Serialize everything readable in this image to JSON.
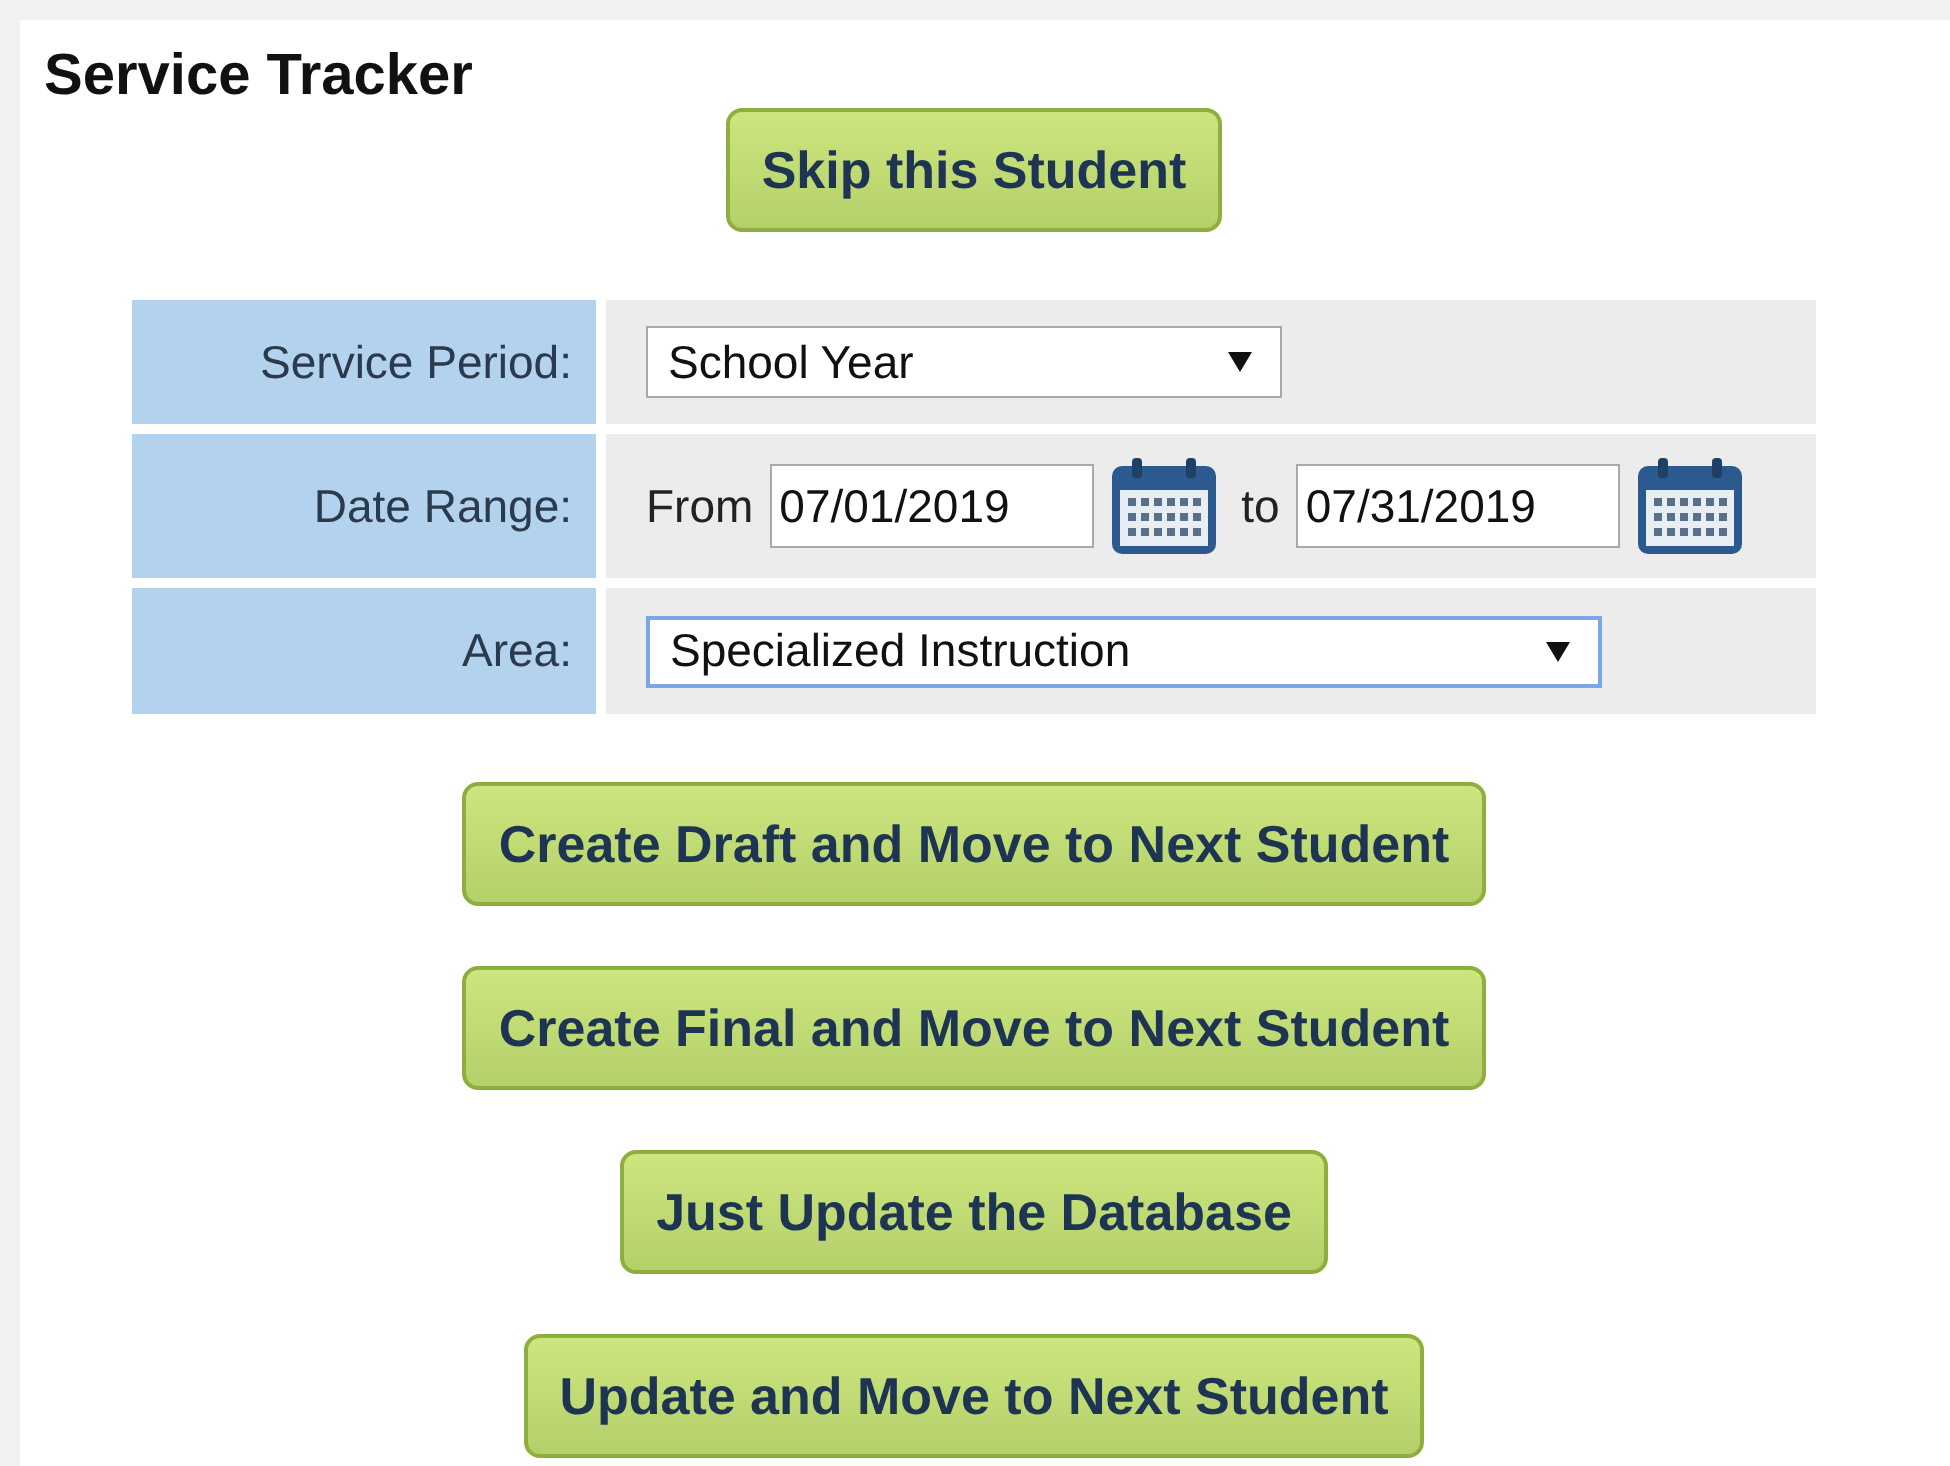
{
  "title": "Service Tracker",
  "skip_button": "Skip this Student",
  "form_rows": [
    {
      "kind": "select",
      "label": "Service Period:",
      "value": "School Year",
      "focused": false,
      "wide": false
    },
    {
      "kind": "date_range",
      "label": "Date Range:",
      "from_label": "From",
      "from_value": "07/01/2019",
      "to_label": "to",
      "to_value": "07/31/2019"
    },
    {
      "kind": "select",
      "label": "Area:",
      "value": "Specialized Instruction",
      "focused": true,
      "wide": true
    }
  ],
  "action_buttons": [
    "Create Draft and Move to Next Student",
    "Create Final and Move to Next Student",
    "Just Update the Database",
    "Update and Move to Next Student"
  ]
}
